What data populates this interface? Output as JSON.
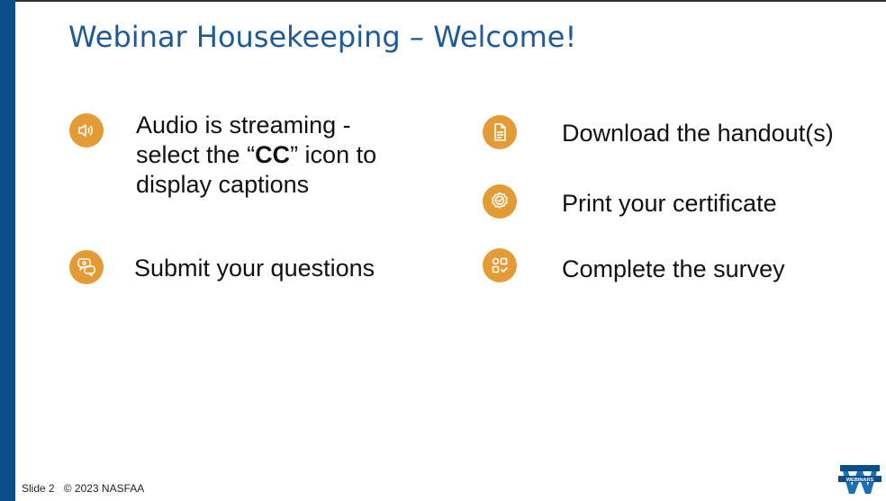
{
  "slide": {
    "title": "Webinar Housekeeping – Welcome!",
    "left_items": [
      {
        "icon": "speaker-icon",
        "lines": [
          "Audio is streaming -",
          "select the “",
          "CC",
          "” icon to",
          "display captions"
        ]
      },
      {
        "icon": "chat-question-icon",
        "label": "Submit your questions"
      }
    ],
    "right_items": [
      {
        "icon": "document-icon",
        "label": "Download the handout(s)"
      },
      {
        "icon": "certificate-badge-icon",
        "label": "Print your certificate"
      },
      {
        "icon": "survey-icon",
        "label": "Complete the survey"
      }
    ],
    "footer": {
      "slide_label": "Slide 2",
      "copyright": "© 2023 NASFAA"
    },
    "logo_text": "WEBINARS",
    "colors": {
      "accent_blue": "#0b4f8a",
      "title_blue": "#1d5a96",
      "icon_orange": "#e39b35"
    }
  }
}
